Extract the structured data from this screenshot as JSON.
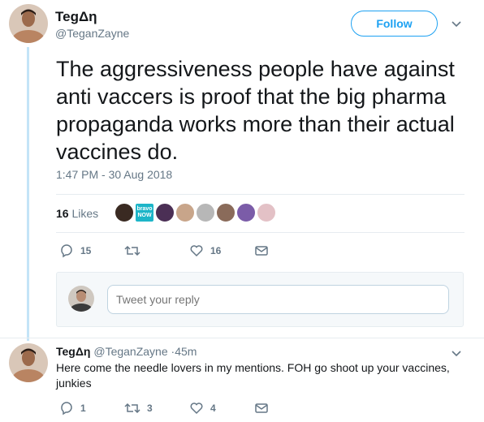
{
  "tweet": {
    "author_name": "TegΔη",
    "author_handle": "@TeganZayne",
    "follow_label": "Follow",
    "text": "The aggressiveness people have against anti vaccers is proof that the big pharma propaganda works more than their actual vaccines do.",
    "timestamp": "1:47 PM - 30 Aug 2018",
    "likes_count": "16",
    "likes_label": "Likes",
    "liker_badge_text": "bravo NOW",
    "actions": {
      "reply_count": "15",
      "retweet_count": "",
      "like_count": "16"
    }
  },
  "reply_box": {
    "placeholder": "Tweet your reply"
  },
  "reply": {
    "author_name": "TegΔη",
    "author_handle": "@TeganZayne",
    "separator": "·",
    "time": "45m",
    "text": "Here come the needle lovers in my mentions. FOH go shoot up your vaccines, junkies",
    "actions": {
      "reply_count": "1",
      "retweet_count": "3",
      "like_count": "4"
    }
  },
  "colors": {
    "accent": "#1da1f2",
    "muted": "#657786",
    "thread_line": "#c4e4f7"
  },
  "icons": [
    "avatar",
    "chevron-down-icon",
    "reply-icon",
    "retweet-icon",
    "heart-icon",
    "message-icon"
  ]
}
